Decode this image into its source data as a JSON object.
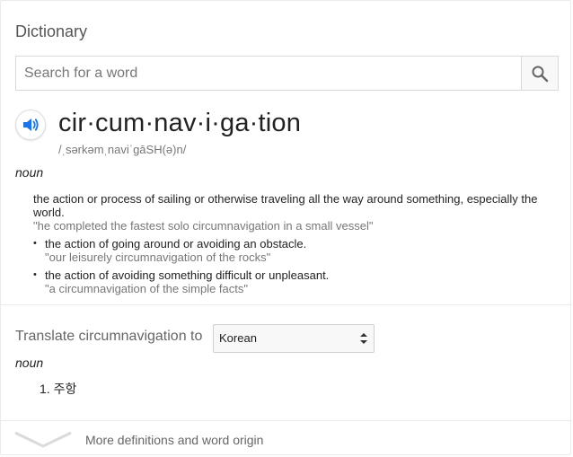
{
  "card": {
    "title": "Dictionary"
  },
  "search": {
    "placeholder": "Search for a word",
    "value": "",
    "button_icon": "search-icon"
  },
  "entry": {
    "speaker_icon": "speaker-icon",
    "headword": "cir·cum·nav·i·ga·tion",
    "phonetic": "/ˌsərkəmˌnaviˈgāSH(ə)n/",
    "part_of_speech": "noun",
    "definition": "the action or process of sailing or otherwise traveling all the way around something, especially the world.",
    "example": "\"he completed the fastest solo circumnavigation in a small vessel\"",
    "subsenses": [
      {
        "bullet": "•",
        "text": "the action of going around or avoiding an obstacle.",
        "example": "\"our leisurely circumnavigation of the rocks\""
      },
      {
        "bullet": "•",
        "text": "the action of avoiding something difficult or unpleasant.",
        "example": "\"a circumnavigation of the simple facts\""
      }
    ]
  },
  "translate": {
    "label": "Translate circumnavigation to",
    "selected_language": "Korean",
    "part_of_speech": "noun",
    "items": [
      "1. 주항"
    ]
  },
  "footer": {
    "more_link": "More definitions and word origin",
    "chevron_icon": "chevron-down-icon"
  },
  "colors": {
    "accent_blue": "#1a73e8",
    "muted_text": "#777777",
    "divider": "#ebebeb"
  }
}
